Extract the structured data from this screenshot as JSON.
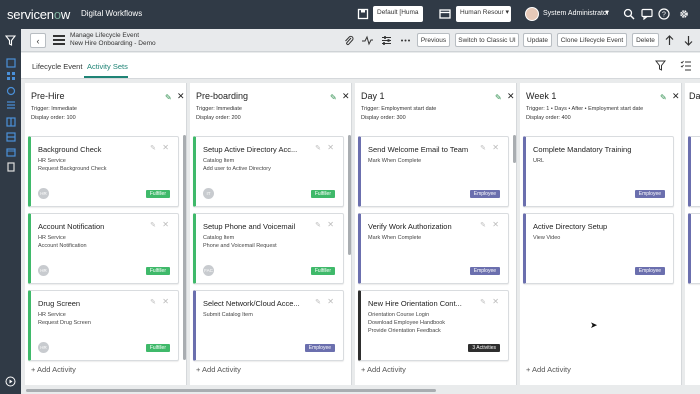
{
  "brand": {
    "name_a": "servicen",
    "name_o": "o",
    "name_b": "w",
    "subtitle": "Digital Workflows"
  },
  "topbar": {
    "scope_select": "Default [Huma",
    "app_select": "Human Resour",
    "user_name": "System Administrator",
    "icons": [
      "scope-icon",
      "app-icon",
      "search-icon",
      "chat-icon",
      "help-icon",
      "settings-icon"
    ]
  },
  "header": {
    "title_line1": "Manage Lifecycle Event",
    "title_line2": "New Hire Onboarding - Demo",
    "buttons": {
      "previous": "Previous",
      "classic": "Switch to Classic UI",
      "update": "Update",
      "clone": "Clone Lifecycle Event",
      "delete": "Delete"
    }
  },
  "tabs": [
    {
      "label": "Lifecycle Event",
      "active": false
    },
    {
      "label": "Activity Sets",
      "active": true
    }
  ],
  "columns": [
    {
      "title": "Pre-Hire",
      "trigger": "Trigger: Immediate",
      "order": "Display order: 100",
      "add": "+ Add Activity",
      "cards": [
        {
          "title": "Background Check",
          "lines": [
            "HR Service",
            "Request Background Check"
          ],
          "avatar": "HR",
          "badge": "Fulfiller",
          "style": "green"
        },
        {
          "title": "Account Notification",
          "lines": [
            "HR Service",
            "Account Notification"
          ],
          "avatar": "HR",
          "badge": "Fulfiller",
          "style": "green"
        },
        {
          "title": "Drug Screen",
          "lines": [
            "HR Service",
            "Request Drug Screen"
          ],
          "avatar": "HR",
          "badge": "Fulfiller",
          "style": "green"
        }
      ]
    },
    {
      "title": "Pre-boarding",
      "trigger": "Trigger: Immediate",
      "order": "Display order: 200",
      "add": "+ Add Activity",
      "cards": [
        {
          "title": "Setup Active Directory Acc...",
          "lines": [
            "Catalog Item",
            "Add user to Active Directory"
          ],
          "avatar": "IT",
          "badge": "Fulfiller",
          "style": "green"
        },
        {
          "title": "Setup Phone and Voicemail",
          "lines": [
            "Catalog Item",
            "Phone and Voicemail Request"
          ],
          "avatar": "FAC",
          "badge": "Fulfiller",
          "style": "green"
        },
        {
          "title": "Select Network/Cloud Acce...",
          "lines": [
            "Submit Catalog Item"
          ],
          "avatar": "",
          "badge": "Employee",
          "style": "purple"
        }
      ]
    },
    {
      "title": "Day 1",
      "trigger": "Trigger: Employment start date",
      "order": "Display order: 300",
      "add": "+ Add Activity",
      "cards": [
        {
          "title": "Send Welcome Email to Team",
          "lines": [
            "Mark When Complete"
          ],
          "avatar": "",
          "badge": "Employee",
          "style": "purple"
        },
        {
          "title": "Verify Work Authorization",
          "lines": [
            "Mark When Complete"
          ],
          "avatar": "",
          "badge": "Employee",
          "style": "purple"
        },
        {
          "title": "New Hire Orientation Cont...",
          "lines": [
            "Orientation Course Login",
            "Download Employee Handbook",
            "Provide Orientation Feedback"
          ],
          "avatar": "",
          "badge": "3 Activities",
          "style": "dark"
        }
      ]
    },
    {
      "title": "Week 1",
      "trigger": "Trigger: 1 • Days • After • Employment start date",
      "order": "Display order: 400",
      "add": "+ Add Activity",
      "cards": [
        {
          "title": "Complete Mandatory Training",
          "lines": [
            "URL"
          ],
          "avatar": "",
          "badge": "Employee",
          "style": "purple"
        },
        {
          "title": "Active Directory Setup",
          "lines": [
            "View Video"
          ],
          "avatar": "",
          "badge": "Employee",
          "style": "purple"
        }
      ]
    },
    {
      "title": "Da",
      "partial": true
    }
  ]
}
